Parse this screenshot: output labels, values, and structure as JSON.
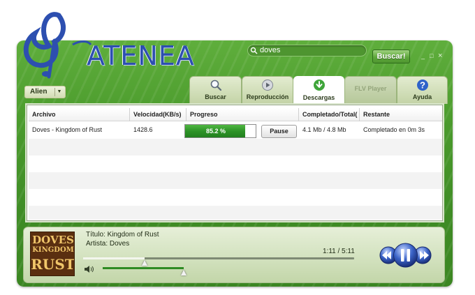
{
  "app": {
    "logo_text": "ATENEA"
  },
  "header": {
    "search": {
      "value": "doves"
    },
    "search_button_label": "Buscar!",
    "window_controls": {
      "minimize": "_",
      "maximize": "□",
      "close": "×"
    }
  },
  "user_menu": {
    "selected": "Alien"
  },
  "tabs": [
    {
      "label": "Buscar",
      "icon": "magnifier-icon",
      "active": false,
      "enabled": true
    },
    {
      "label": "Reproducción",
      "icon": "play-icon",
      "active": false,
      "enabled": true
    },
    {
      "label": "Descargas",
      "icon": "download-arrow-icon",
      "active": true,
      "enabled": true
    },
    {
      "label": "FLV Player",
      "icon": "",
      "active": false,
      "enabled": false
    },
    {
      "label": "Ayuda",
      "icon": "help-icon",
      "active": false,
      "enabled": true
    }
  ],
  "downloads": {
    "columns": [
      "Archivo",
      "Velocidad(KB/s)",
      "Progreso",
      "Completado/Total(",
      "Restante"
    ],
    "rows": [
      {
        "archivo": "Doves - Kingdom of Rust",
        "velocidad": "1428.6",
        "progress_text": "85.2 %",
        "progress_fraction": 0.852,
        "pause_label": "Pause",
        "completado": "4.1 Mb / 4.8 Mb",
        "restante": "Completado en 0m 3s"
      }
    ]
  },
  "player": {
    "title_line": "Título:  Kingdom of Rust",
    "artist_line": "Artista: Doves",
    "time": "1:11 / 5:11",
    "seek_fraction": 0.228,
    "volume_fraction": 1.0,
    "album_art": {
      "line1": "DOVES",
      "line2": "KINGDOM",
      "line3": "RUST"
    }
  },
  "colors": {
    "frame_green": "#4a9a2c",
    "progress_green": "#2e9328",
    "logo_blue": "#2d4fb0"
  }
}
